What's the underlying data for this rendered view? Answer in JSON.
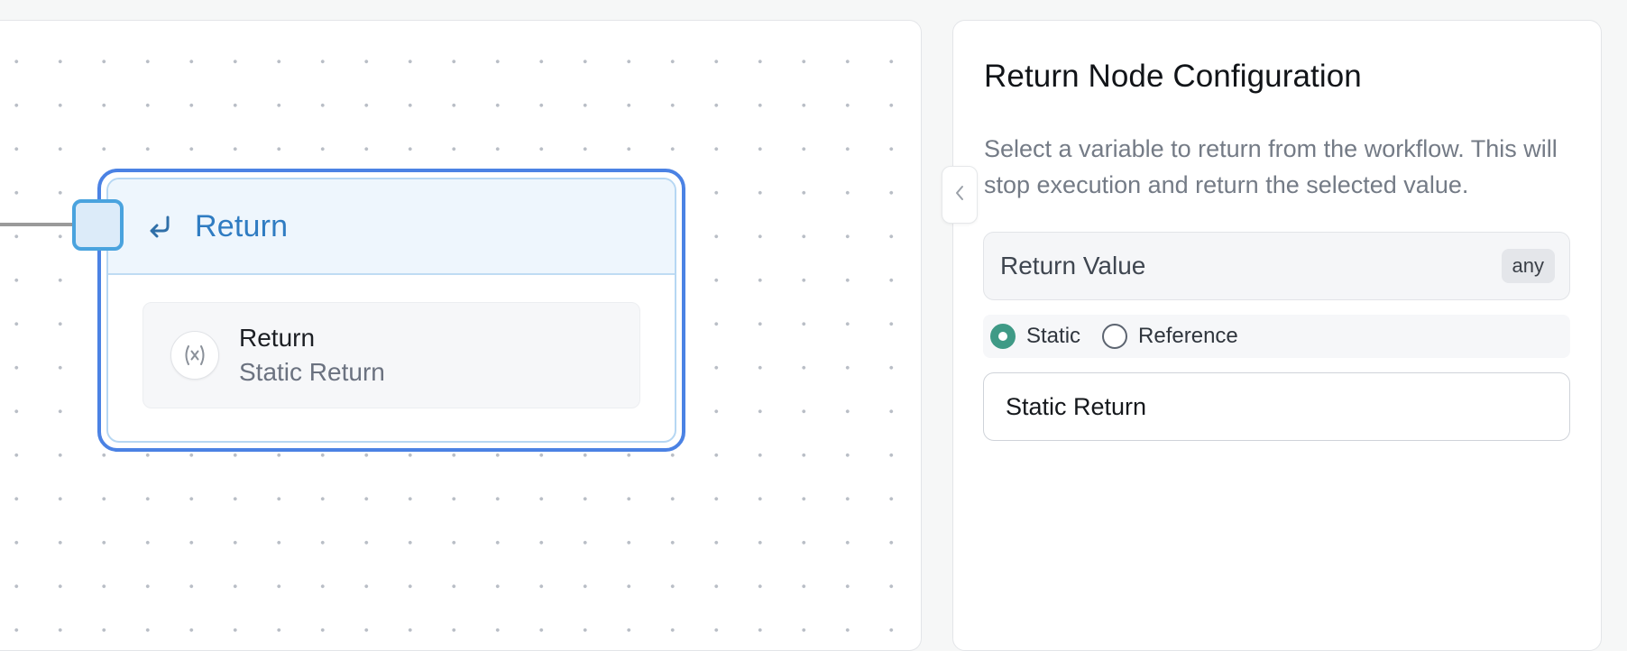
{
  "canvas": {
    "node": {
      "title": "Return",
      "header_icon": "return-arrow-icon",
      "variable": {
        "icon": "variable-x-icon",
        "icon_glyph": "(x)",
        "name": "Return",
        "value": "Static Return"
      }
    },
    "collapse_icon": "chevron-left-icon"
  },
  "config_panel": {
    "title": "Return Node Configuration",
    "description": "Select a variable to return from the workflow. This will stop execution and return the selected value.",
    "field": {
      "label": "Return Value",
      "type_badge": "any"
    },
    "mode_options": [
      {
        "label": "Static",
        "selected": true
      },
      {
        "label": "Reference",
        "selected": false
      }
    ],
    "static_value": "Static Return"
  },
  "colors": {
    "selection_border": "#4b82e4",
    "node_header_bg": "#eef6fd",
    "node_title": "#2f7cc2",
    "handle_border": "#4aa3de",
    "radio_checked": "#3f9a86"
  }
}
